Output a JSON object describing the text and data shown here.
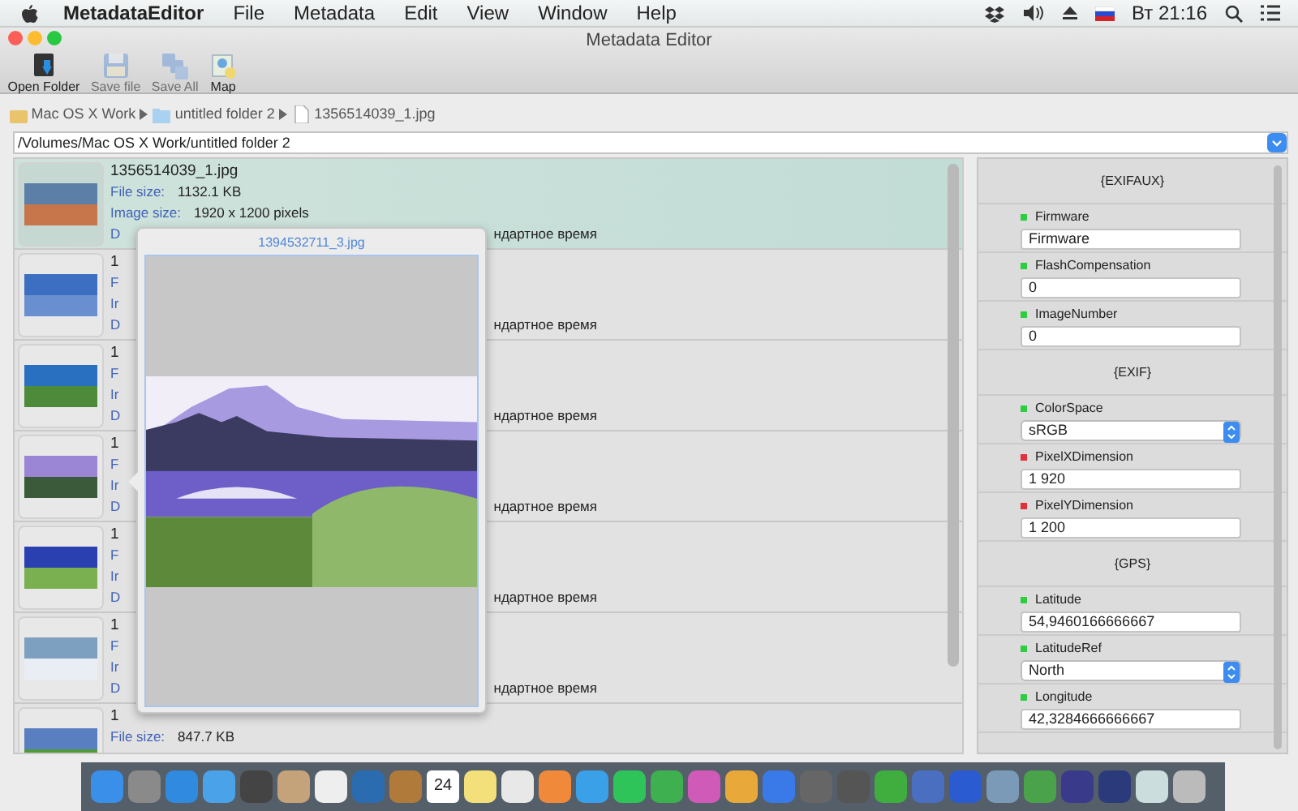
{
  "menu_bar": {
    "app_name": "MetadataEditor",
    "menus": [
      "File",
      "Metadata",
      "Edit",
      "View",
      "Window",
      "Help"
    ],
    "clock": "Вт 21:16"
  },
  "window": {
    "title": "Metadata Editor"
  },
  "toolbar": [
    {
      "label": "Open Folder",
      "kind": "folder",
      "disabled": false
    },
    {
      "label": "Save file",
      "kind": "save",
      "disabled": true
    },
    {
      "label": "Save All",
      "kind": "saveall",
      "disabled": true
    },
    {
      "label": "Map",
      "kind": "map",
      "disabled": false
    }
  ],
  "breadcrumb": [
    {
      "label": "Mac OS X Work",
      "kind": "drive"
    },
    {
      "label": "untitled folder 2",
      "kind": "folder"
    },
    {
      "label": "1356514039_1.jpg",
      "kind": "file"
    }
  ],
  "path_field": {
    "value": "/Volumes/Mac OS X Work/untitled folder 2"
  },
  "files": [
    {
      "selected": true,
      "name": "1356514039_1.jpg",
      "size_label": "File size:",
      "size": "1132.1 KB",
      "dims_label": "Image size:",
      "dims": "1920 x 1200 pixels",
      "date_label": "D",
      "date": "ндартное время"
    },
    {
      "selected": false,
      "name": "1",
      "size_label": "F",
      "dims_label": "Ir",
      "date_label": "D",
      "date": "ндартное время"
    },
    {
      "selected": false,
      "name": "1",
      "size_label": "F",
      "dims_label": "Ir",
      "date_label": "D",
      "date": "ндартное время"
    },
    {
      "selected": false,
      "name": "1",
      "size_label": "F",
      "dims_label": "Ir",
      "date_label": "D",
      "date": "ндартное время"
    },
    {
      "selected": false,
      "name": "1",
      "size_label": "F",
      "dims_label": "Ir",
      "date_label": "D",
      "date": "ндартное время"
    },
    {
      "selected": false,
      "name": "1",
      "size_label": "F",
      "dims_label": "Ir",
      "date_label": "D",
      "date": "ндартное время"
    },
    {
      "selected": false,
      "name": "1",
      "size_label": "File size:",
      "size": "847.7 KB"
    }
  ],
  "preview_popover": {
    "title": "1394532711_3.jpg"
  },
  "metadata": [
    {
      "title": "{EXIFAUX}",
      "fields": [
        {
          "label": "Firmware",
          "color": "#2ecc40",
          "kind": "text",
          "value": "Firmware"
        },
        {
          "label": "FlashCompensation",
          "color": "#2ecc40",
          "kind": "text",
          "value": "0"
        },
        {
          "label": "ImageNumber",
          "color": "#2ecc40",
          "kind": "text",
          "value": "0"
        }
      ]
    },
    {
      "title": "{EXIF}",
      "fields": [
        {
          "label": "ColorSpace",
          "color": "#2ecc40",
          "kind": "select",
          "value": "sRGB"
        },
        {
          "label": "PixelXDimension",
          "color": "#e0303a",
          "kind": "text",
          "value": "1 920"
        },
        {
          "label": "PixelYDimension",
          "color": "#e0303a",
          "kind": "text",
          "value": "1 200"
        }
      ]
    },
    {
      "title": "{GPS}",
      "fields": [
        {
          "label": "Latitude",
          "color": "#2ecc40",
          "kind": "text",
          "value": "54,9460166666667"
        },
        {
          "label": "LatitudeRef",
          "color": "#2ecc40",
          "kind": "select",
          "value": "North"
        },
        {
          "label": "Longitude",
          "color": "#2ecc40",
          "kind": "text",
          "value": "42,3284666666667"
        }
      ]
    }
  ],
  "dock": {
    "calendar_day": "24"
  }
}
